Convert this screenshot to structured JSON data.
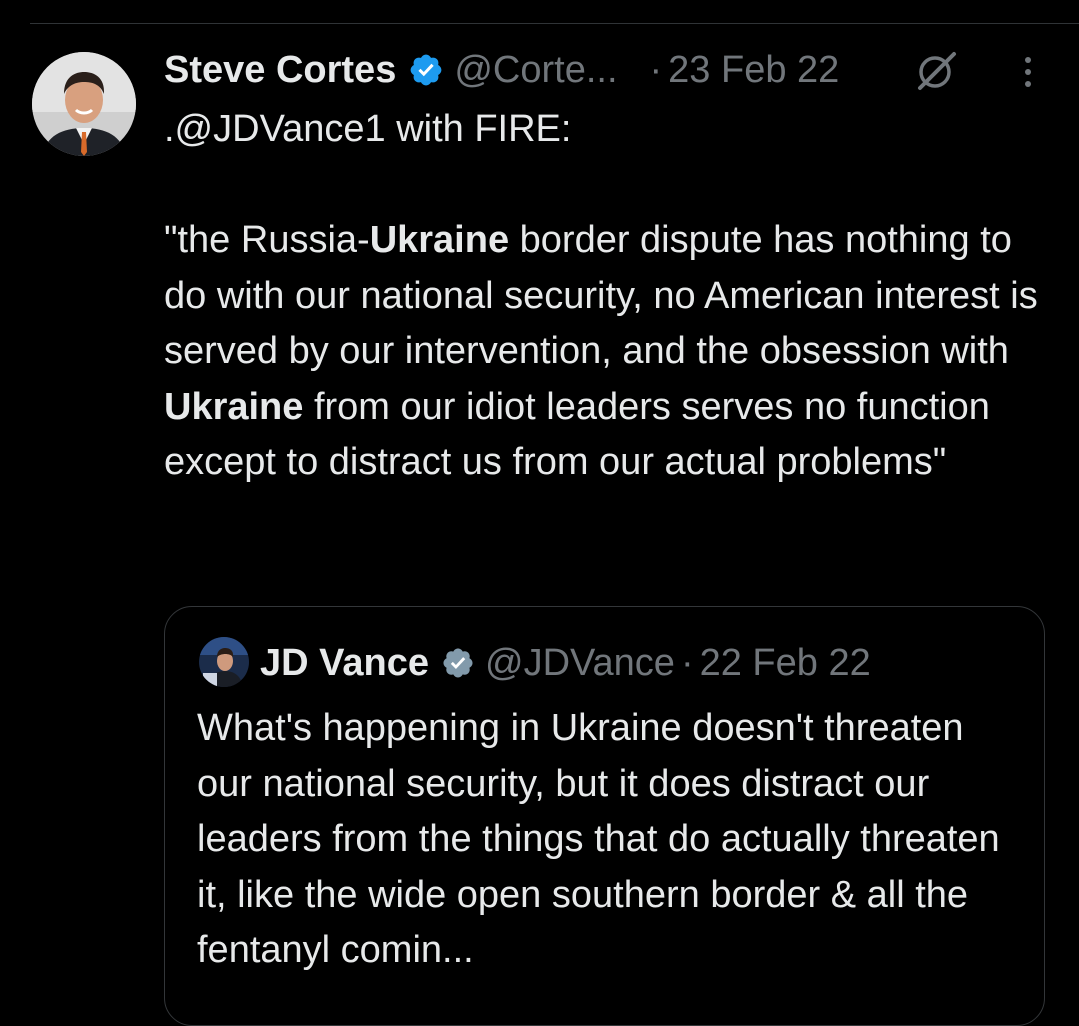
{
  "tweet": {
    "author": {
      "name": "Steve Cortes",
      "handle": "@Corte...",
      "avatar_icon": "profile-photo-man-in-suit"
    },
    "separator": "·",
    "date": "23 Feb 22",
    "text": {
      "line1": ".@JDVance1 with FIRE:",
      "q_open": "\"the Russia-",
      "bold1": "Ukraine",
      "mid1": " border dispute has nothing to do with our national security, no American interest is served by our intervention, and the obsession with ",
      "bold2": "Ukraine",
      "mid2": " from our idiot leaders serves no function except to distract us from our actual problems\""
    },
    "icons": [
      "verified-badge-icon",
      "grok-icon",
      "more-options-icon"
    ],
    "accent_color": "#1d9bf0"
  },
  "quoted_tweet": {
    "author": {
      "name": "JD Vance",
      "handle": "@JDVance",
      "avatar_icon": "profile-photo-man-at-podium"
    },
    "separator": "·",
    "date": "22 Feb 22",
    "text": "What's happening in Ukraine doesn't threaten our national security, but it does distract our leaders from the things that do actually threaten it, like the wide open southern border & all the fentanyl comin..."
  },
  "colors": {
    "background": "#000000",
    "primary_text": "#e7e9ea",
    "secondary_text": "#71767b",
    "border": "#2f3336"
  }
}
